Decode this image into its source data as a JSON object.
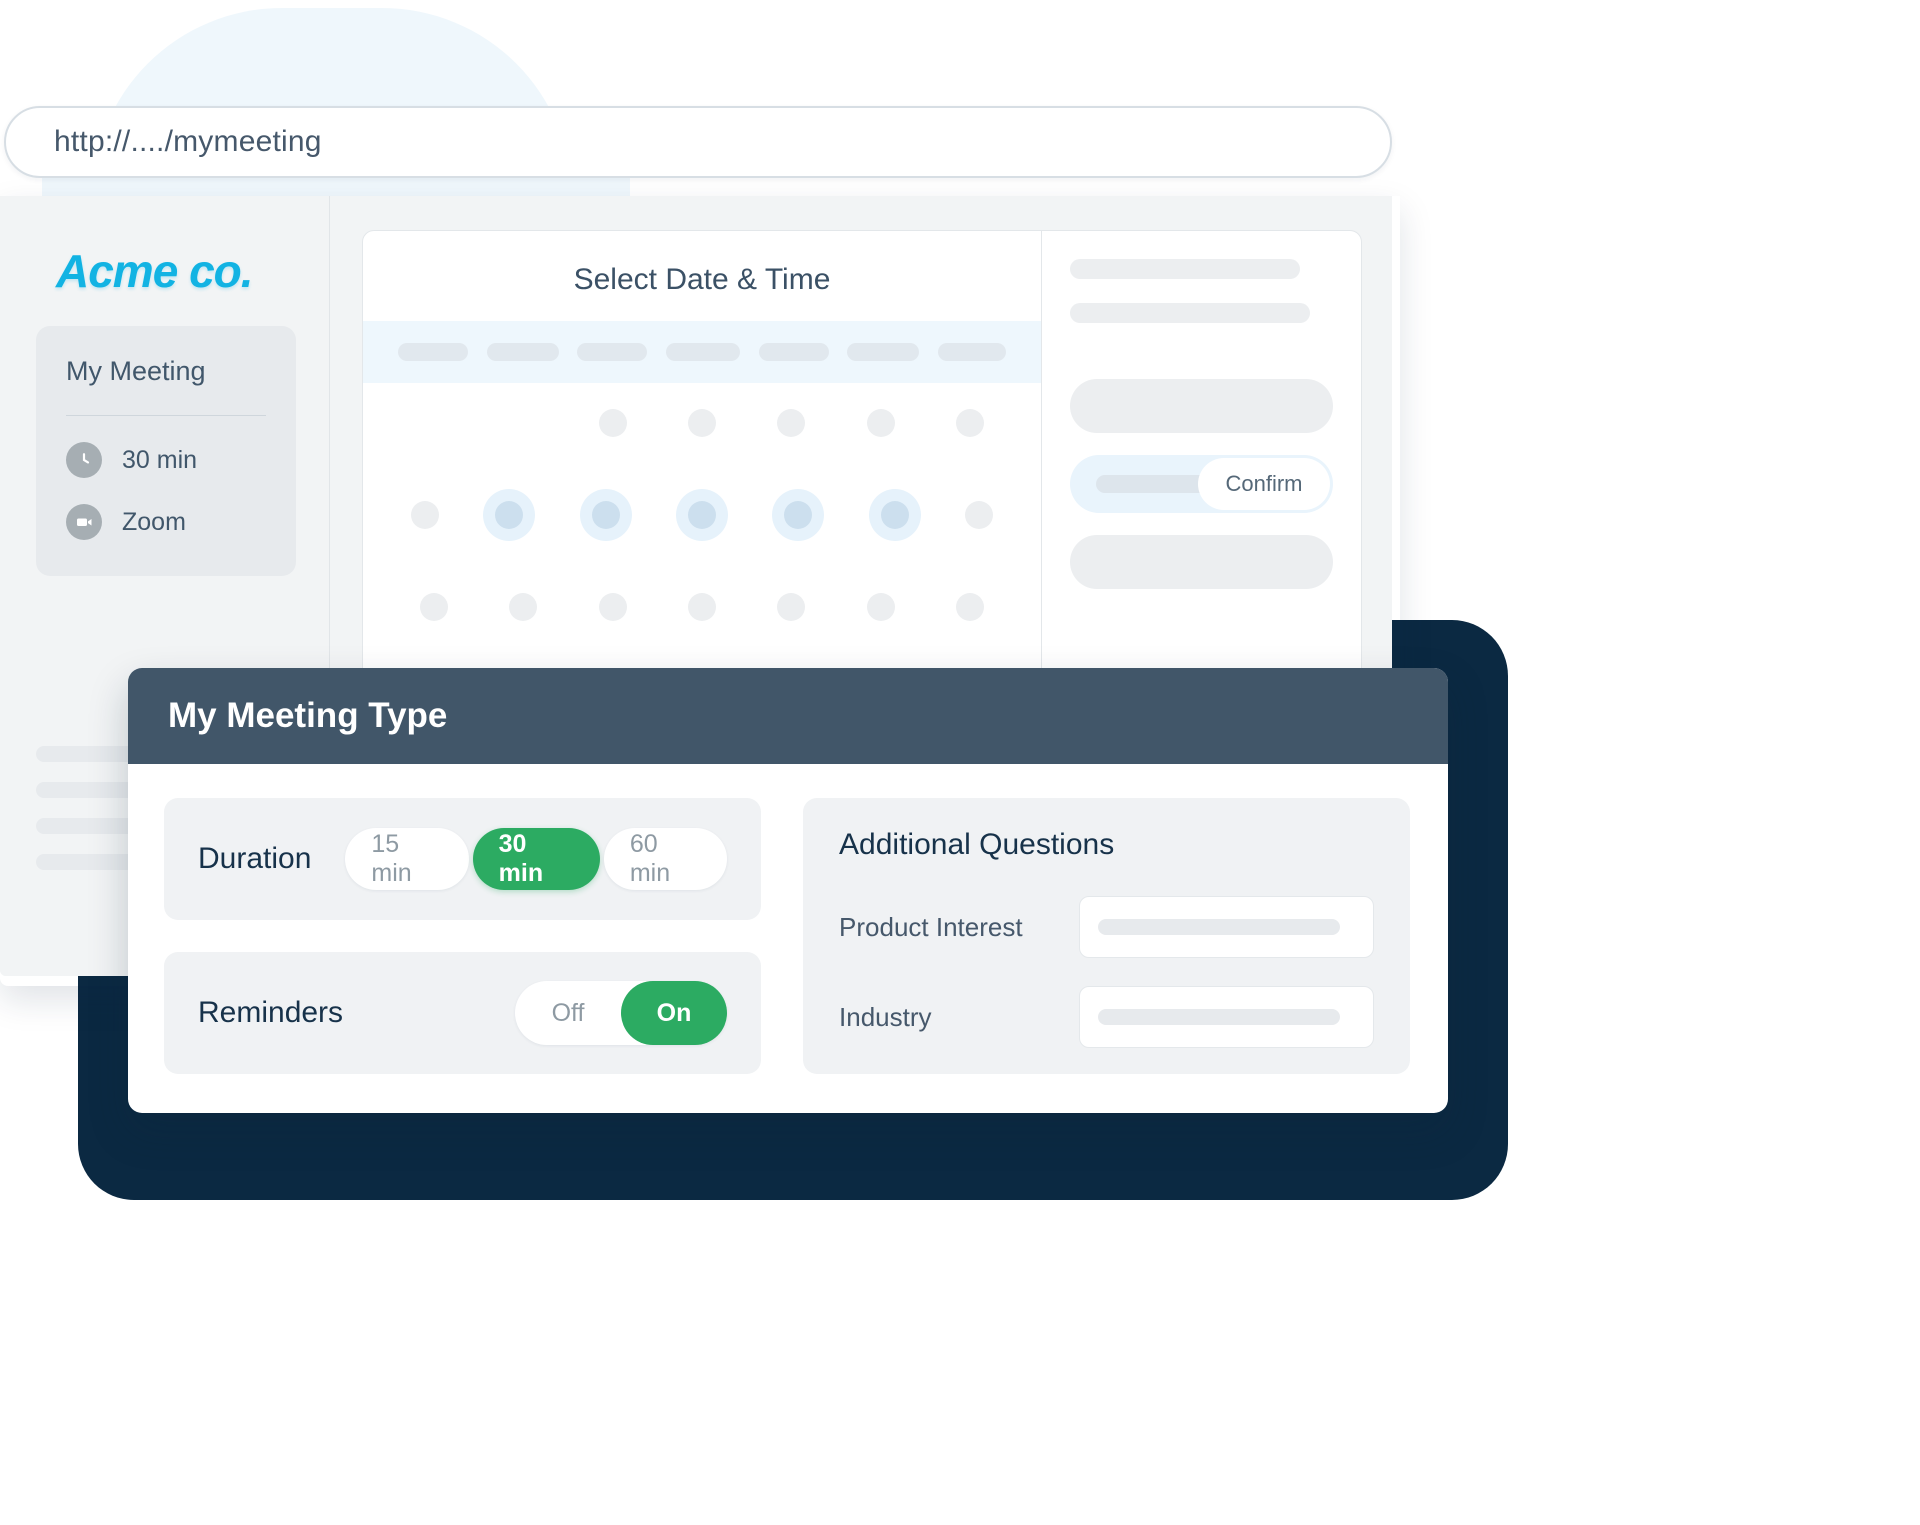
{
  "browser": {
    "url": "http://..../mymeeting"
  },
  "sidebar": {
    "brand": "Acme co.",
    "card": {
      "title": "My Meeting",
      "meta": [
        {
          "icon": "clock-icon",
          "label": "30 min"
        },
        {
          "icon": "video-camera-icon",
          "label": "Zoom"
        }
      ]
    },
    "skeleton_lines": [
      190,
      170,
      200,
      150
    ]
  },
  "calendar": {
    "title": "Select Date & Time",
    "weekday_pills": [
      70,
      72,
      70,
      74,
      70,
      72,
      68
    ],
    "dot_rows": [
      [
        "empty",
        "empty",
        "dot",
        "dot",
        "dot",
        "dot",
        "dot"
      ],
      [
        "dot",
        "sel",
        "sel",
        "sel",
        "sel",
        "sel",
        "dot"
      ],
      [
        "dot",
        "dot",
        "dot",
        "dot",
        "dot",
        "dot",
        "dot"
      ]
    ]
  },
  "booking_panel": {
    "skeleton_lines": [
      230,
      240
    ],
    "boxes": [
      "box",
      "confirm",
      "box"
    ],
    "confirm_label": "Confirm"
  },
  "modal": {
    "title": "My Meeting Type",
    "duration": {
      "label": "Duration",
      "options": [
        {
          "label": "15 min",
          "selected": false
        },
        {
          "label": "30 min",
          "selected": true
        },
        {
          "label": "60 min",
          "selected": false
        }
      ]
    },
    "reminders": {
      "label": "Reminders",
      "options": [
        {
          "label": "Off",
          "selected": false
        },
        {
          "label": "On",
          "selected": true
        }
      ]
    },
    "questions": {
      "title": "Additional Questions",
      "fields": [
        {
          "label": "Product Interest",
          "value": ""
        },
        {
          "label": "Industry",
          "value": ""
        }
      ]
    }
  },
  "colors": {
    "brand_cyan": "#12b3e3",
    "accent_green": "#2cab62",
    "modal_header": "#415669",
    "navy_backdrop": "#0b2942",
    "text_dark": "#17324a"
  }
}
